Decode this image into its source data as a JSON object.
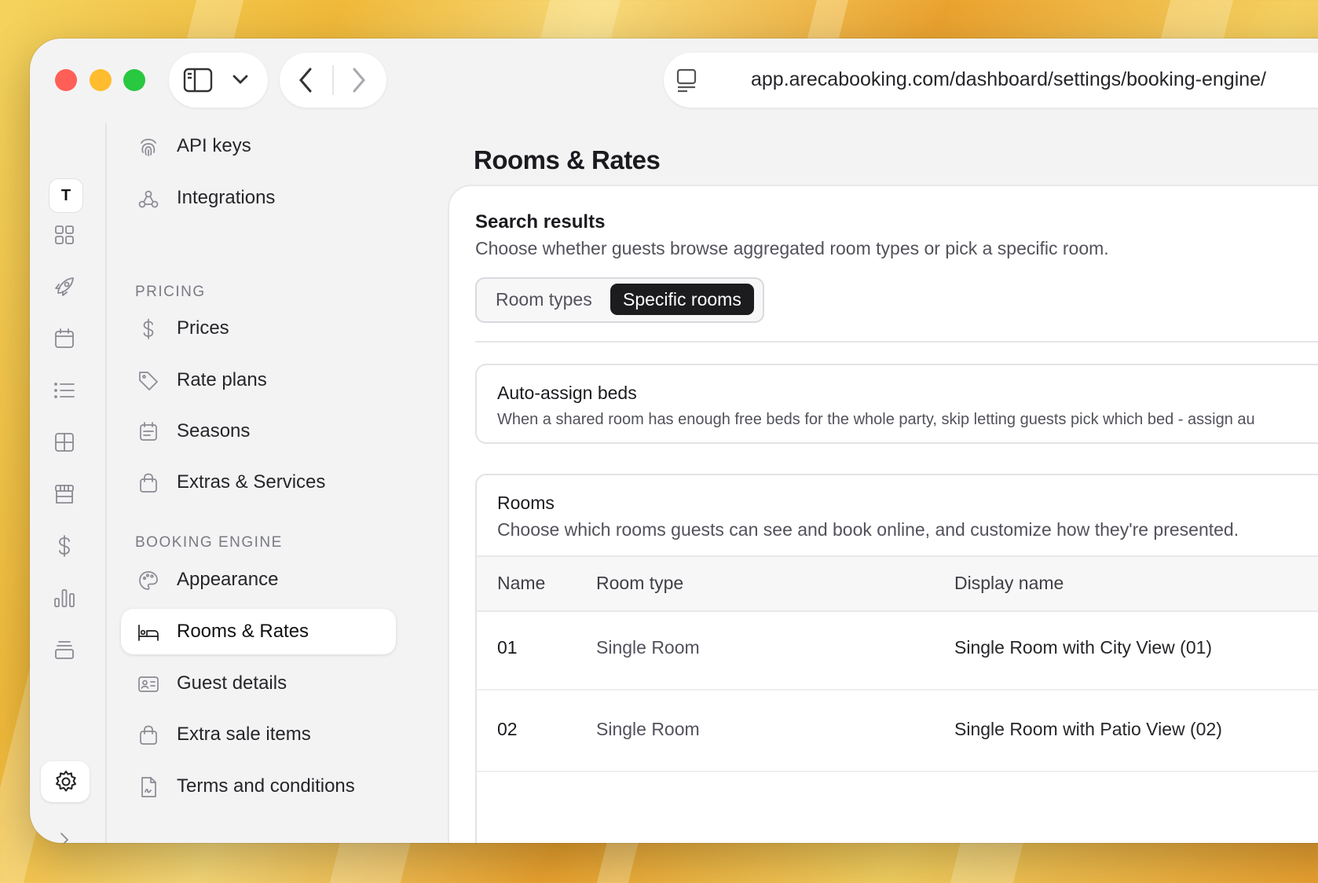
{
  "browser": {
    "url": "app.arecabooking.com/dashboard/settings/booking-engine/",
    "traffic_colors": [
      "#ff5f57",
      "#febc2e",
      "#28c840"
    ]
  },
  "rail": {
    "workspace_initial": "T",
    "icons": [
      "grid-icon",
      "rocket-icon",
      "calendar-icon",
      "list-icon",
      "layout-icon",
      "store-icon",
      "dollar-icon",
      "bar-chart-icon",
      "stack-icon",
      "gear-icon",
      "chevron-right-icon"
    ]
  },
  "nav": {
    "items_top": [
      {
        "label": "API keys",
        "icon": "fingerprint-icon"
      },
      {
        "label": "Integrations",
        "icon": "webhook-icon"
      }
    ],
    "pricing_title": "PRICING",
    "pricing": [
      {
        "label": "Prices",
        "icon": "dollar-icon"
      },
      {
        "label": "Rate plans",
        "icon": "tag-icon"
      },
      {
        "label": "Seasons",
        "icon": "calendar-icon"
      },
      {
        "label": "Extras & Services",
        "icon": "shopping-bag-icon"
      }
    ],
    "booking_title": "BOOKING ENGINE",
    "booking": [
      {
        "label": "Appearance",
        "icon": "palette-icon"
      },
      {
        "label": "Rooms & Rates",
        "icon": "bed-icon",
        "active": true
      },
      {
        "label": "Guest details",
        "icon": "id-card-icon"
      },
      {
        "label": "Extra sale items",
        "icon": "shopping-bag-icon"
      },
      {
        "label": "Terms and conditions",
        "icon": "file-signature-icon"
      }
    ]
  },
  "main": {
    "title": "Rooms & Rates",
    "search": {
      "title": "Search results",
      "description": "Choose whether guests browse aggregated room types or pick a specific room.",
      "options": [
        "Room types",
        "Specific rooms"
      ],
      "selected": "Specific rooms"
    },
    "auto_assign": {
      "title": "Auto-assign beds",
      "description": "When a shared room has enough free beds for the whole party, skip letting guests pick which bed - assign au"
    },
    "rooms": {
      "title": "Rooms",
      "description": "Choose which rooms guests can see and book online, and customize how they're presented.",
      "columns": [
        "Name",
        "Room type",
        "Display name"
      ],
      "rows": [
        {
          "name": "01",
          "room_type": "Single Room",
          "display_name": "Single Room with City View (01)"
        },
        {
          "name": "02",
          "room_type": "Single Room",
          "display_name": "Single Room with Patio View (02)"
        }
      ]
    }
  }
}
